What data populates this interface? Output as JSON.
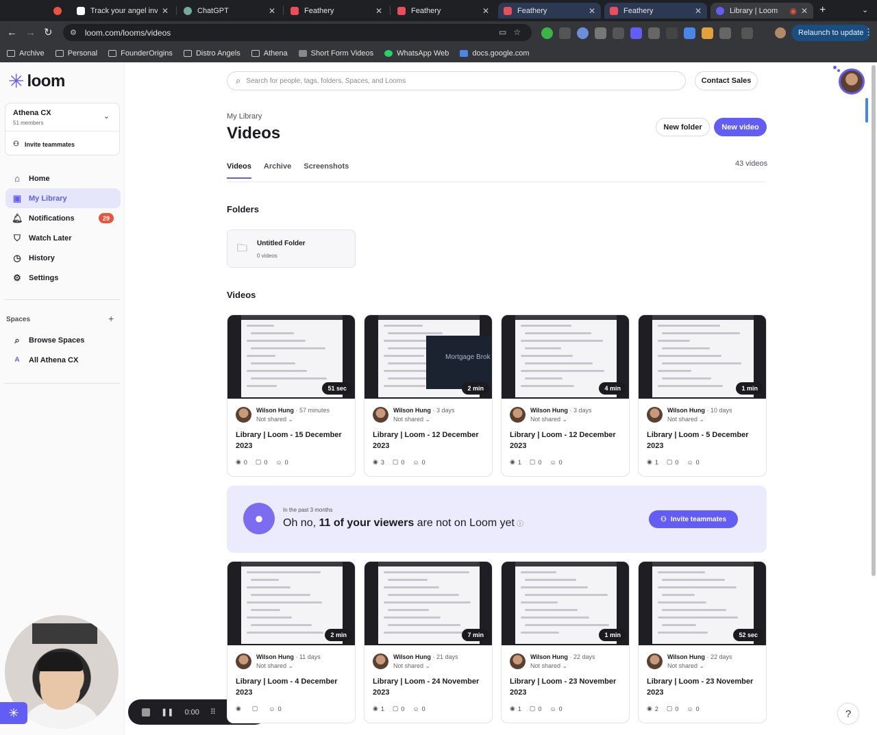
{
  "browser": {
    "tabs": [
      {
        "label": "",
        "icon": "record-icon",
        "color": "#e8553e"
      },
      {
        "label": "Track your angel investments",
        "icon": "x-favicon",
        "color": "#ffffff"
      },
      {
        "label": "ChatGPT",
        "icon": "chatgpt-favicon",
        "color": "#74aa9c"
      },
      {
        "label": "Feathery",
        "icon": "feathery-favicon",
        "color": "#e94f5b"
      },
      {
        "label": "Feathery",
        "icon": "feathery-favicon",
        "color": "#e94f5b"
      },
      {
        "label": "Feathery",
        "icon": "feathery-favicon",
        "color": "#e94f5b"
      },
      {
        "label": "Feathery",
        "icon": "feathery-favicon",
        "color": "#e94f5b"
      },
      {
        "label": "Library | Loom",
        "icon": "loom-favicon",
        "color": "#625df5"
      }
    ],
    "url": "loom.com/looms/videos",
    "relaunch_label": "Relaunch to update",
    "bookmarks": [
      {
        "label": "Archive",
        "icon": "folder-icon"
      },
      {
        "label": "Personal",
        "icon": "folder-icon"
      },
      {
        "label": "FounderOrigins",
        "icon": "folder-icon"
      },
      {
        "label": "Distro Angels",
        "icon": "folder-icon"
      },
      {
        "label": "Athena",
        "icon": "folder-icon"
      },
      {
        "label": "Short Form Videos",
        "icon": "site-icon"
      },
      {
        "label": "WhatsApp Web",
        "icon": "whatsapp-icon"
      },
      {
        "label": "docs.google.com",
        "icon": "docs-icon"
      }
    ]
  },
  "sidebar": {
    "logo": "loom",
    "workspace": {
      "name": "Athena CX",
      "members": "51 members",
      "invite_label": "Invite teammates"
    },
    "nav": [
      {
        "label": "Home",
        "icon": "home-icon"
      },
      {
        "label": "My Library",
        "icon": "library-icon"
      },
      {
        "label": "Notifications",
        "icon": "bell-icon",
        "badge": "29"
      },
      {
        "label": "Watch Later",
        "icon": "bookmark-icon"
      },
      {
        "label": "History",
        "icon": "clock-icon"
      },
      {
        "label": "Settings",
        "icon": "gear-icon"
      }
    ],
    "spaces_heading": "Spaces",
    "spaces": [
      {
        "label": "Browse Spaces",
        "icon": "search-icon"
      },
      {
        "label": "All Athena CX",
        "icon": "letter-a-icon",
        "letter": "A"
      }
    ]
  },
  "header": {
    "search_placeholder": "Search for people, tags, folders, Spaces, and Looms",
    "contact_label": "Contact Sales"
  },
  "page": {
    "breadcrumb": "My Library",
    "title": "Videos",
    "new_folder_label": "New folder",
    "new_video_label": "New video",
    "tabs": [
      "Videos",
      "Archive",
      "Screenshots"
    ],
    "count": "43 videos",
    "folders_heading": "Folders",
    "videos_heading": "Videos",
    "folder": {
      "name": "Untitled Folder",
      "count": "0 videos"
    }
  },
  "videos": [
    {
      "duration": "51 sec",
      "author": "Wilson Hung",
      "age": "57 minutes",
      "share": "Not shared",
      "title": "Library | Loom - 15 December 2023",
      "views": "0",
      "comments": "0",
      "reactions": "0"
    },
    {
      "duration": "2 min",
      "author": "Wilson Hung",
      "age": "3 days",
      "share": "Not shared",
      "title": "Library | Loom - 12 December 2023",
      "views": "3",
      "comments": "0",
      "reactions": "0",
      "thumb_text": "Mortgage Brok"
    },
    {
      "duration": "4 min",
      "author": "Wilson Hung",
      "age": "3 days",
      "share": "Not shared",
      "title": "Library | Loom - 12 December 2023",
      "views": "1",
      "comments": "0",
      "reactions": "0"
    },
    {
      "duration": "1 min",
      "author": "Wilson Hung",
      "age": "10 days",
      "share": "Not shared",
      "title": "Library | Loom - 5 December 2023",
      "views": "1",
      "comments": "0",
      "reactions": "0"
    },
    {
      "duration": "2 min",
      "author": "Wilson Hung",
      "age": "11 days",
      "share": "Not shared",
      "title": "Library | Loom - 4 December 2023",
      "views": "",
      "comments": "",
      "reactions": "0"
    },
    {
      "duration": "7 min",
      "author": "Wilson Hung",
      "age": "21 days",
      "share": "Not shared",
      "title": "Library | Loom - 24 November 2023",
      "views": "1",
      "comments": "0",
      "reactions": "0"
    },
    {
      "duration": "1 min",
      "author": "Wilson Hung",
      "age": "22 days",
      "share": "Not shared",
      "title": "Library | Loom - 23 November 2023",
      "views": "1",
      "comments": "0",
      "reactions": "0"
    },
    {
      "duration": "52 sec",
      "author": "Wilson Hung",
      "age": "22 days",
      "share": "Not shared",
      "title": "Library | Loom - 23 November 2023",
      "views": "2",
      "comments": "0",
      "reactions": "0"
    }
  ],
  "banner": {
    "sub": "In the past 3 months",
    "pre": "Oh no, ",
    "bold": "11 of your viewers",
    "post": " are not on Loom yet",
    "invite_label": "Invite teammates"
  },
  "recorder": {
    "time": "0:00"
  },
  "help_label": "?",
  "colors": {
    "accent": "#625df5",
    "badge": "#e8553e"
  }
}
